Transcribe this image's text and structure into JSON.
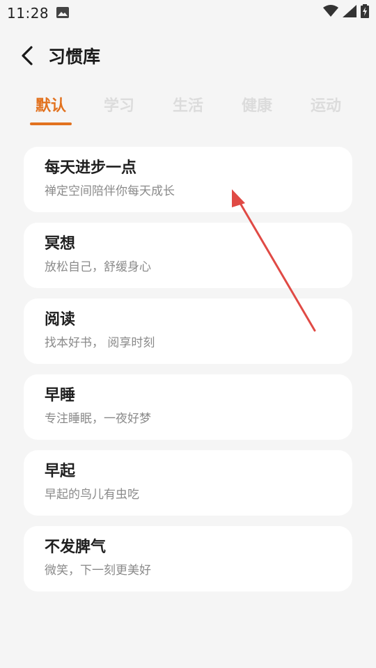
{
  "status_bar": {
    "time": "11:28"
  },
  "header": {
    "title": "习惯库"
  },
  "tabs": [
    {
      "label": "默认",
      "active": true
    },
    {
      "label": "学习",
      "active": false
    },
    {
      "label": "生活",
      "active": false
    },
    {
      "label": "健康",
      "active": false
    },
    {
      "label": "运动",
      "active": false
    }
  ],
  "habits": [
    {
      "title": "每天进步一点",
      "subtitle": "禅定空间陪伴你每天成长"
    },
    {
      "title": "冥想",
      "subtitle": "放松自己，舒缓身心"
    },
    {
      "title": "阅读",
      "subtitle": "找本好书， 阅享时刻"
    },
    {
      "title": "早睡",
      "subtitle": "专注睡眠，一夜好梦"
    },
    {
      "title": "早起",
      "subtitle": "早起的鸟儿有虫吃"
    },
    {
      "title": "不发脾气",
      "subtitle": "微笑，下一刻更美好"
    }
  ],
  "colors": {
    "accent": "#e2721f",
    "background": "#f5f5f5",
    "annotation_arrow": "#e04a45"
  }
}
